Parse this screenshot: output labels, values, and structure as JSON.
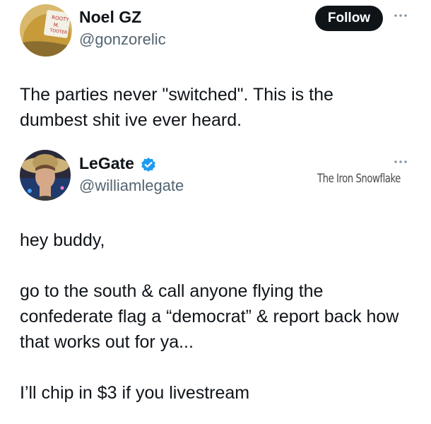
{
  "original_tweet": {
    "display_name": "Noel GZ",
    "handle": "@gonzorelic",
    "follow_label": "Follow",
    "more_icon": "more-dots-icon",
    "text": "The parties never \"switched\". This is the dumbest shit ive ever heard."
  },
  "reply_tweet": {
    "display_name": "LeGate",
    "handle": "@williamlegate",
    "verified_icon": "verified-badge-icon",
    "verified_color": "#1d9bf0",
    "more_icon": "more-dots-icon",
    "watermark": "The Iron Snowflake",
    "paragraphs": [
      "hey buddy,",
      "go to the south & call anyone flying the confederate flag a “democrat” & report back how that works out for ya...",
      "I’ll chip in $3 if you livestream"
    ]
  }
}
